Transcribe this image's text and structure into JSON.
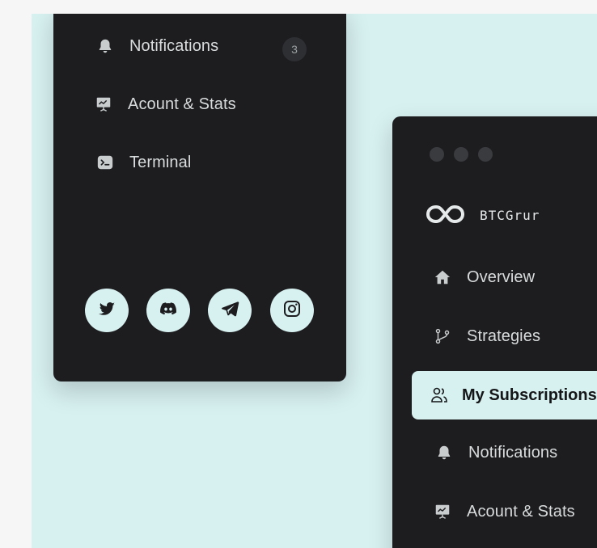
{
  "left_panel": {
    "nav": [
      {
        "label": "Notifications",
        "icon": "bell-icon",
        "badge": "3"
      },
      {
        "label": "Acount & Stats",
        "icon": "presentation-chart-icon"
      },
      {
        "label": "Terminal",
        "icon": "terminal-icon"
      }
    ],
    "social": [
      "twitter-icon",
      "discord-icon",
      "telegram-icon",
      "instagram-icon"
    ]
  },
  "right_panel": {
    "window_dots": 3,
    "brand": {
      "logo_icon": "btcgurur-logo-icon",
      "text": "BTCGrur"
    },
    "nav": [
      {
        "label": "Overview",
        "icon": "home-icon"
      },
      {
        "label": "Strategies",
        "icon": "git-branch-icon"
      },
      {
        "label": "My Subscriptions",
        "icon": "users-icon",
        "active": true
      },
      {
        "label": "Notifications",
        "icon": "bell-icon"
      },
      {
        "label": "Acount & Stats",
        "icon": "presentation-chart-icon"
      }
    ]
  },
  "colors": {
    "page_bg": "#f6f6f6",
    "canvas_bg": "#d7f0f0",
    "panel_bg": "#1d1d20",
    "text": "#d8dcdc",
    "accent": "#d7f0f0",
    "badge_bg": "#2e2f33"
  }
}
